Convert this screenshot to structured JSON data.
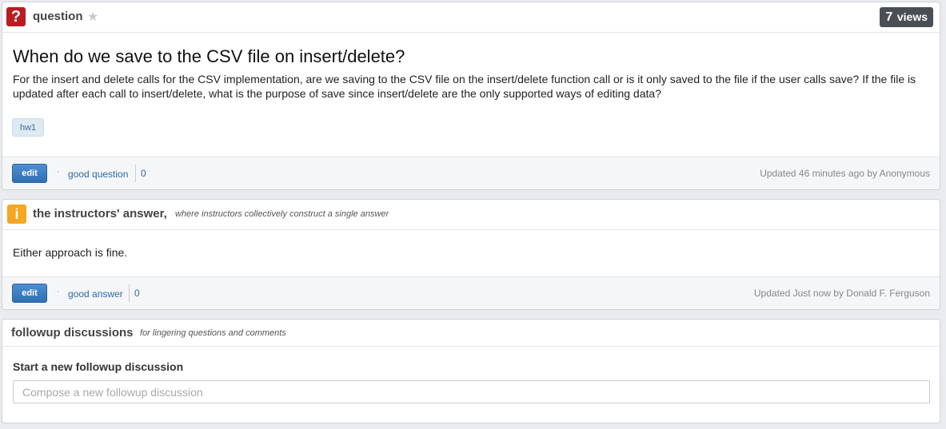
{
  "question": {
    "header_label": "question",
    "views_count": "7",
    "views_label": "views",
    "title": "When do we save to the CSV file on insert/delete?",
    "body": "For the insert and delete calls for the CSV implementation, are we saving to the CSV file on the insert/delete function call or is it only saved to the file if the user calls save? If the file is updated after each call to insert/delete, what is the purpose of save since insert/delete are the only supported ways of editing data?",
    "tag": "hw1",
    "edit_label": "edit",
    "separator": "·",
    "good_label": "good question",
    "good_count": "0",
    "updated": "Updated 46 minutes ago by Anonymous",
    "icon_glyph": "?",
    "icon_color": "#b91d22"
  },
  "answer": {
    "title": "the instructors' answer,",
    "subtitle": "where instructors collectively construct a single answer",
    "body": "Either approach is fine.",
    "edit_label": "edit",
    "separator": "·",
    "good_label": "good answer",
    "good_count": "0",
    "updated": "Updated Just now by Donald F. Ferguson",
    "icon_glyph": "i",
    "icon_color": "#f5a623"
  },
  "followup": {
    "title": "followup discussions",
    "subtitle": "for lingering questions and comments",
    "start_label": "Start a new followup discussion",
    "input_placeholder": "Compose a new followup discussion",
    "input_value": ""
  },
  "colors": {
    "accent_button": "#2e6fb3",
    "link": "#2f6aa6",
    "views_badge": "#4a4f55"
  }
}
